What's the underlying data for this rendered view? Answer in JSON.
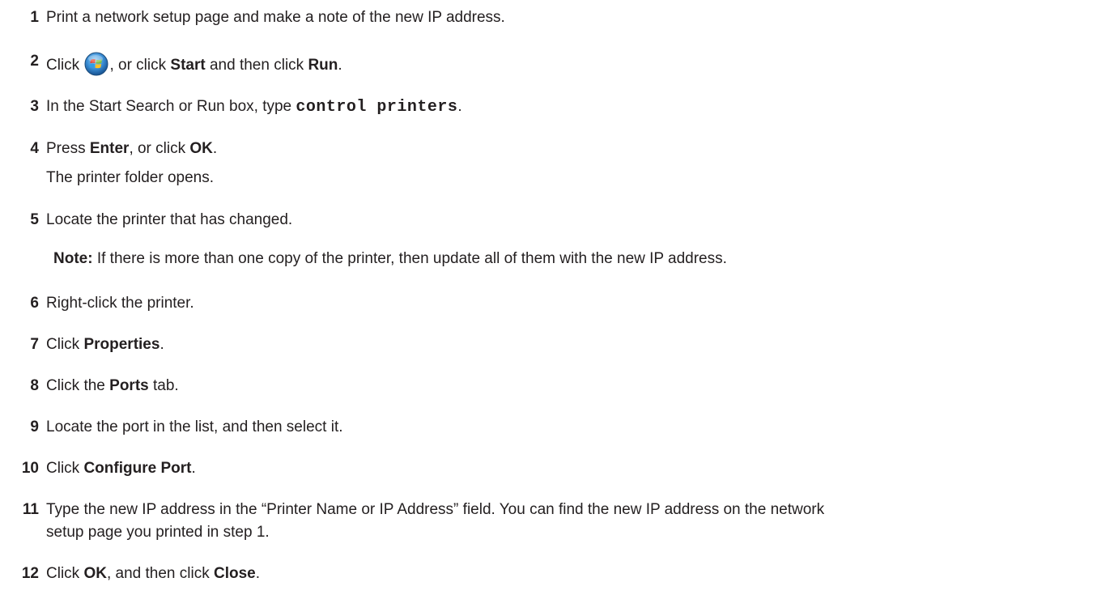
{
  "steps": [
    {
      "num": "1",
      "text": "Print a network setup page and make a note of the new IP address."
    },
    {
      "num": "2",
      "pre": "Click ",
      "mid1": ", or click ",
      "b1": "Start",
      "mid2": " and then click ",
      "b2": "Run",
      "post": "."
    },
    {
      "num": "3",
      "pre": "In the Start Search or Run box, type ",
      "code": "control printers",
      "post": "."
    },
    {
      "num": "4",
      "pre": "Press ",
      "b1": "Enter",
      "mid1": ", or click ",
      "b2": "OK",
      "post": ".",
      "sub": "The printer folder opens."
    },
    {
      "num": "5",
      "text": "Locate the printer that has changed."
    },
    {
      "note_label": "Note:",
      "note_text": " If there is more than one copy of the printer, then update all of them with the new IP address."
    },
    {
      "num": "6",
      "text": "Right-click the printer."
    },
    {
      "num": "7",
      "pre": "Click ",
      "b1": "Properties",
      "post": "."
    },
    {
      "num": "8",
      "pre": "Click the ",
      "b1": "Ports",
      "post": " tab."
    },
    {
      "num": "9",
      "text": "Locate the port in the list, and then select it."
    },
    {
      "num": "10",
      "pre": "Click ",
      "b1": "Configure Port",
      "post": "."
    },
    {
      "num": "11",
      "line1": "Type the new IP address in the “Printer Name or IP Address” field. You can find the new IP address on the network",
      "line2": "setup page you printed in step 1."
    },
    {
      "num": "12",
      "pre": "Click ",
      "b1": "OK",
      "mid1": ", and then click ",
      "b2": "Close",
      "post": "."
    }
  ],
  "icons": {
    "start_logo": "windows-start-orb-icon"
  }
}
